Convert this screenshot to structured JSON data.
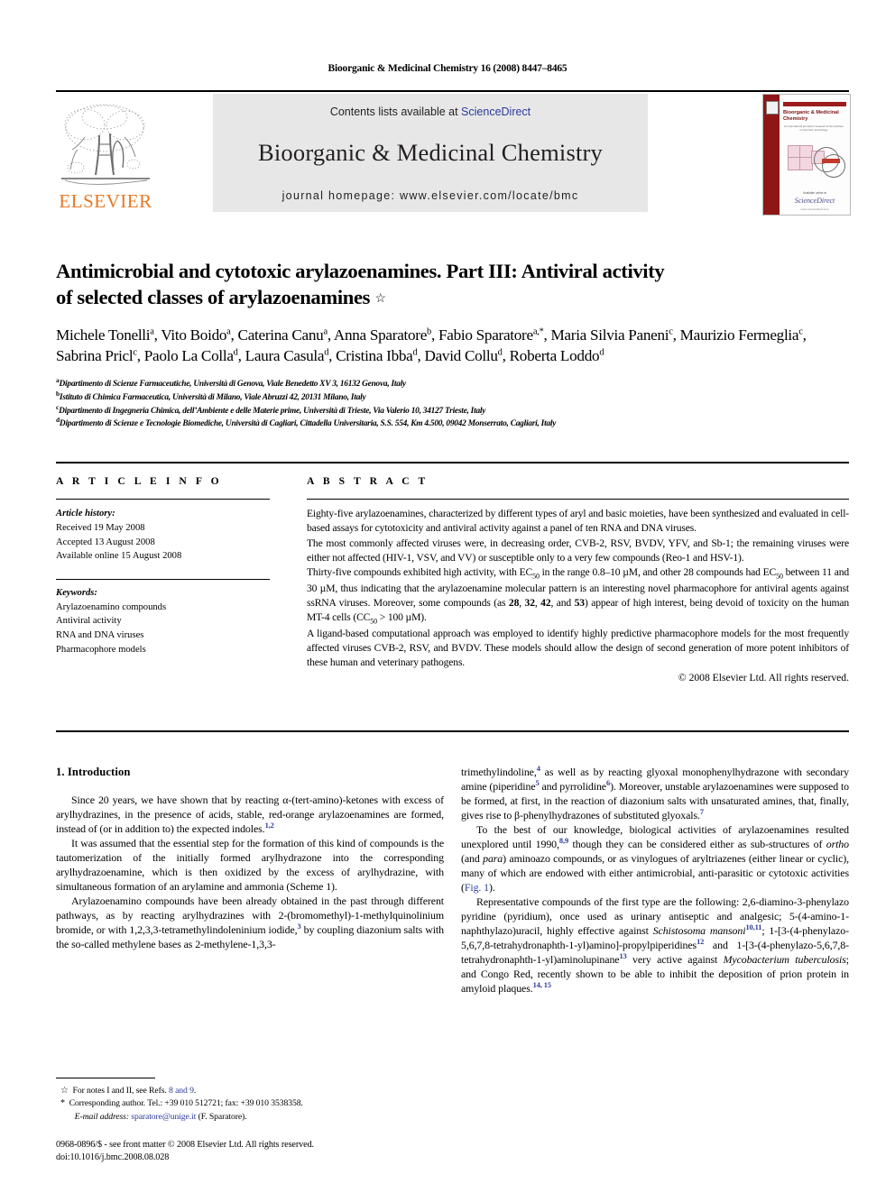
{
  "running_head": "Bioorganic & Medicinal Chemistry 16 (2008) 8447–8465",
  "masthead": {
    "publisher_name": "ELSEVIER",
    "contents_prefix": "Contents lists available at ",
    "sciencedirect": "ScienceDirect",
    "journal_title": "Bioorganic & Medicinal Chemistry",
    "homepage": "journal homepage: www.elsevier.com/locate/bmc",
    "link_color": "#2b3a9b",
    "band_color": "#e7e7e7",
    "elsevier_orange": "#e87722",
    "cover": {
      "title": "Bioorganic & Medicinal Chemistry",
      "subtitle": "An international journal for research at the interface of chemistry and biology",
      "footer_label": "Available online at",
      "footer_brand": "ScienceDirect",
      "footer_url": "www.sciencedirect.com",
      "accent_color": "#8e1616"
    }
  },
  "article": {
    "title": "Antimicrobial and cytotoxic arylazoenamines. Part III: Antiviral activity of selected classes of arylazoenamines",
    "title_line1": "Antimicrobial and cytotoxic arylazoenamines. Part III: Antiviral activity",
    "title_line2": "of selected classes of arylazoenamines",
    "title_footnote_mark": "☆",
    "authors": [
      {
        "name": "Michele Tonelli",
        "sup": "a"
      },
      {
        "name": "Vito Boido",
        "sup": "a"
      },
      {
        "name": "Caterina Canu",
        "sup": "a"
      },
      {
        "name": "Anna Sparatore",
        "sup": "b"
      },
      {
        "name": "Fabio Sparatore",
        "sup": "a,*"
      },
      {
        "name": "Maria Silvia Paneni",
        "sup": "c"
      },
      {
        "name": "Maurizio Fermeglia",
        "sup": "c"
      },
      {
        "name": "Sabrina Pricl",
        "sup": "c"
      },
      {
        "name": "Paolo La Colla",
        "sup": "d"
      },
      {
        "name": "Laura Casula",
        "sup": "d"
      },
      {
        "name": "Cristina Ibba",
        "sup": "d"
      },
      {
        "name": "David Collu",
        "sup": "d"
      },
      {
        "name": "Roberta Loddo",
        "sup": "d"
      }
    ],
    "affiliations": [
      {
        "mark": "a",
        "text": "Dipartimento di Scienze Farmaceutiche, Università di Genova, Viale Benedetto XV 3, 16132 Genova, Italy"
      },
      {
        "mark": "b",
        "text": "Istituto di Chimica Farmaceutica, Università di Milano, Viale Abruzzi 42, 20131 Milano, Italy"
      },
      {
        "mark": "c",
        "text": "Dipartimento di Ingegneria Chimica, dell’Ambiente e delle Materie prime, Università di Trieste, Via Valerio 10, 34127 Trieste, Italy"
      },
      {
        "mark": "d",
        "text": "Dipartimento di Scienze e Tecnologie Biomediche, Università di Cagliari, Cittadella Universitaria, S.S. 554, Km 4.500, 09042 Monserrato, Cagliari, Italy"
      }
    ]
  },
  "article_info": {
    "heading": "A R T I C L E   I N F O",
    "history_label": "Article history:",
    "history": [
      "Received 19 May 2008",
      "Accepted 13 August 2008",
      "Available online 15 August 2008"
    ],
    "keywords_label": "Keywords:",
    "keywords": [
      "Arylazoenamino compounds",
      "Antiviral activity",
      "RNA and DNA viruses",
      "Pharmacophore models"
    ]
  },
  "abstract": {
    "heading": "A B S T R A C T",
    "paragraphs": [
      "Eighty-five arylazoenamines, characterized by different types of aryl and basic moieties, have been synthesized and evaluated in cell-based assays for cytotoxicity and antiviral activity against a panel of ten RNA and DNA viruses.",
      "The most commonly affected viruses were, in decreasing order, CVB-2, RSV, BVDV, YFV, and Sb-1; the remaining viruses were either not affected (HIV-1, VSV, and VV) or susceptible only to a very few compounds (Reo-1 and HSV-1).",
      "Thirty-five compounds exhibited high activity, with EC50 in the range 0.8–10 µM, and other 28 compounds had EC50 between 11 and 30 µM, thus indicating that the arylazoenamine molecular pattern is an interesting novel pharmacophore for antiviral agents against ssRNA viruses. Moreover, some compounds (as 28, 32, 42, and 53) appear of high interest, being devoid of toxicity on the human MT-4 cells (CC50 > 100 µM).",
      "A ligand-based computational approach was employed to identify highly predictive pharmacophore models for the most frequently affected viruses CVB-2, RSV, and BVDV. These models should allow the design of second generation of more potent inhibitors of these human and veterinary pathogens."
    ],
    "copyright": "© 2008 Elsevier Ltd. All rights reserved."
  },
  "body": {
    "section_heading": "1. Introduction",
    "left_paragraphs": [
      "Since 20 years, we have shown that by reacting α-(tert-amino)-ketones with excess of arylhydrazines, in the presence of acids, stable, red-orange arylazoenamines are formed, instead of (or in addition to) the expected indoles.",
      "It was assumed that the essential step for the formation of this kind of compounds is the tautomerization of the initially formed arylhydrazone into the corresponding arylhydrazoenamine, which is then oxidized by the excess of arylhydrazine, with simultaneous formation of an arylamine and ammonia (Scheme 1).",
      "Arylazoenamino compounds have been already obtained in the past through different pathways, as by reacting arylhydrazines with 2-(bromomethyl)-1-methylquinolinium bromide, or with 1,2,3,3-tetramethylindoleninium iodide, by coupling diazonium salts with the so-called methylene bases as 2-methylene-1,3,3-"
    ],
    "right_paragraphs": [
      "trimethylindoline, as well as by reacting glyoxal monophenylhydrazone with secondary amine (piperidine and pyrrolidine). Moreover, unstable arylazoenamines were supposed to be formed, at first, in the reaction of diazonium salts with unsaturated amines, that, finally, gives rise to β-phenylhydrazones of substituted glyoxals.",
      "To the best of our knowledge, biological activities of arylazoenamines resulted unexplored until 1990, though they can be considered either as sub-structures of ortho (and para) aminoazo compounds, or as vinylogues of aryltriazenes (either linear or cyclic), many of which are endowed with either antimicrobial, antiparasitic or cytotoxic activities (Fig. 1).",
      "Representative compounds of the first type are the following: 2,6-diamino-3-phenylazo pyridine (pyridium), once used as urinary antiseptic and analgesic; 5-(4-amino-1-naphthylazo)uracil, highly effective against Schistosoma mansoni; 1-[3-(4-phenylazo-5,6,7,8-tetrahydronaphth-1-yl)amino]-propylpiperidines and 1-[3-(4-phenylazo-5,6,7,8-tetrahydronaphth-1-yl)aminolupinane very active against Mycobacterium tuberculosis; and Congo Red, recently shown to be able to inhibit the deposition of prion protein in amyloid plaques."
    ],
    "citation_refs": [
      "1,2",
      "3",
      "4",
      "5",
      "6",
      "7",
      "8,9",
      "10,11",
      "12",
      "13",
      "14, 15"
    ],
    "fig_link": "Fig. 1"
  },
  "footnotes": {
    "note_star": "For notes I and II, see Refs.",
    "note_star_refs": "8 and 9",
    "note_star_tail": ".",
    "corresponding": "Corresponding author. Tel.: +39 010 512721; fax: +39 010 3538358.",
    "email_label": "E-mail address:",
    "email": "sparatore@unige.it",
    "email_owner": "(F. Sparatore)."
  },
  "imprint": {
    "line1": "0968-0896/$ - see front matter © 2008 Elsevier Ltd. All rights reserved.",
    "line2": "doi:10.1016/j.bmc.2008.08.028"
  }
}
